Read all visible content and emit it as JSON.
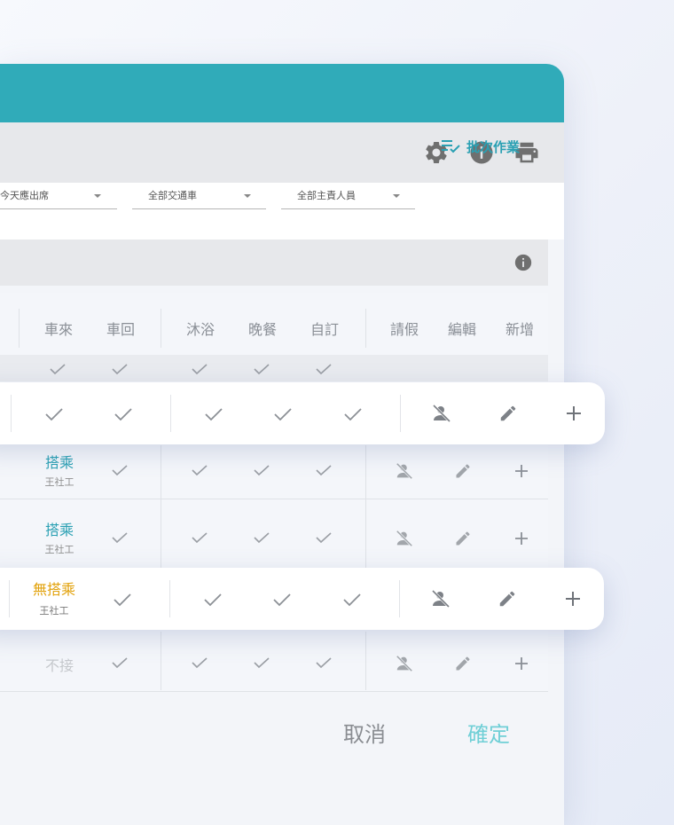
{
  "toolbar": {
    "icons": [
      "gear-icon",
      "info-icon",
      "print-icon"
    ]
  },
  "filters": {
    "attendance": "今天應出席",
    "vehicle": "全部交通車",
    "staff": "全部主責人員",
    "batch_label": "批次作業"
  },
  "table": {
    "headers": [
      "車來",
      "車回",
      "沐浴",
      "晚餐",
      "自訂",
      "請假",
      "編輯",
      "新增"
    ],
    "rows": [
      {
        "status": "",
        "sub": ""
      },
      {
        "status": "",
        "sub": ""
      },
      {
        "status": "搭乘",
        "sub": "王社工"
      },
      {
        "status": "搭乘",
        "sub": "王社工"
      },
      {
        "status": "無搭乘",
        "sub": "王社工"
      },
      {
        "status": "不接",
        "sub": ""
      }
    ]
  },
  "colors": {
    "header_teal": "#30abb9",
    "ride_blue": "#2aa0b3",
    "no_ride_orange": "#e2a20c"
  },
  "footer": {
    "cancel": "取消",
    "confirm": "確定"
  }
}
